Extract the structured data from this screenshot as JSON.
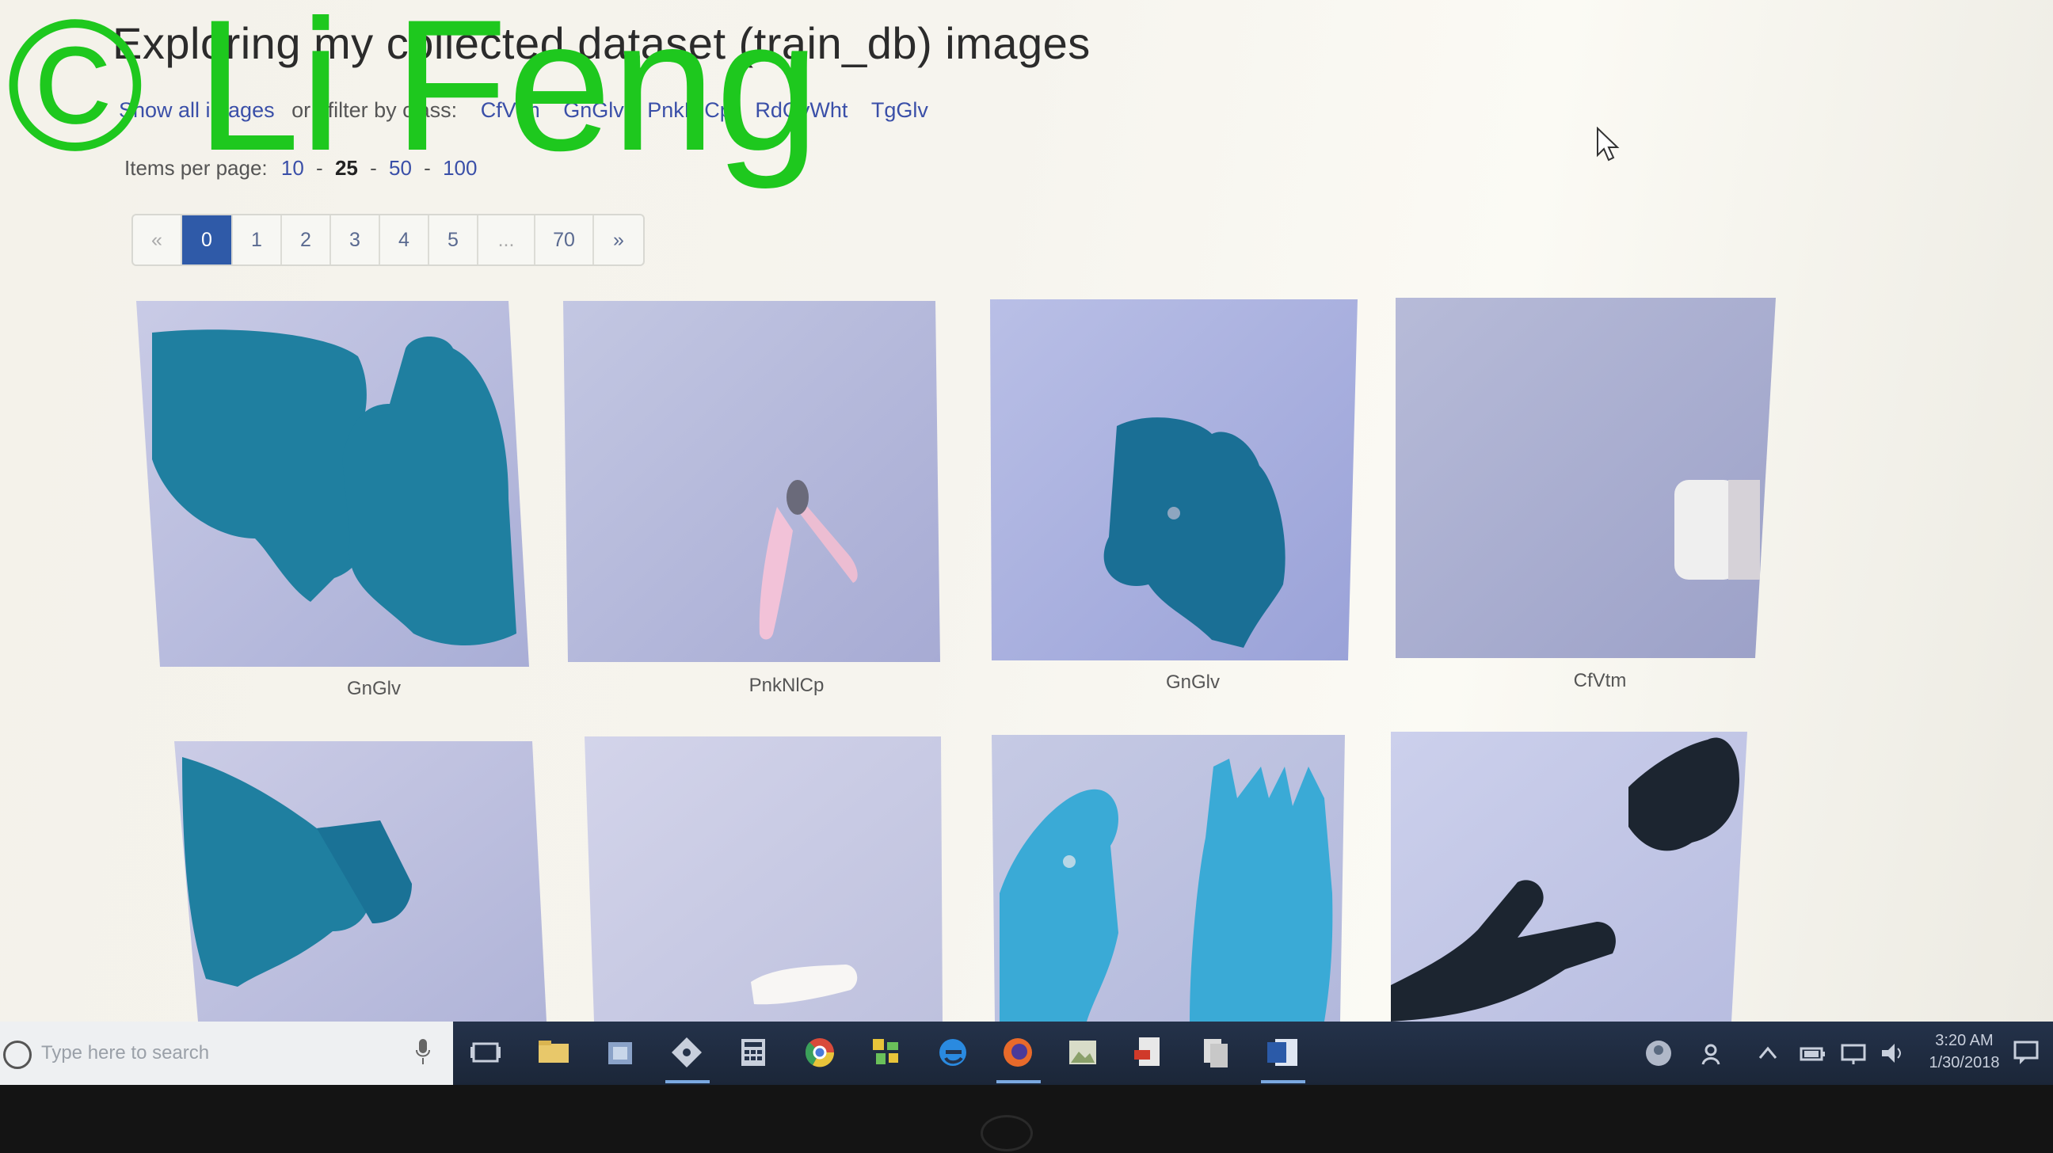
{
  "page": {
    "title": "Exploring my collected dataset (train_db) images",
    "show_all": "Show all images",
    "or": "or",
    "filter_by": "filter by class:",
    "classes": [
      "CfVtm",
      "GnGlv",
      "PnkNlCp",
      "RdGvWht",
      "TgGlv"
    ],
    "items_per_page_label": "Items per page:",
    "items_per_page_options": [
      "10",
      "25",
      "50",
      "100"
    ],
    "items_per_page_current": "25"
  },
  "pagination": {
    "prev": "«",
    "pages": [
      "0",
      "1",
      "2",
      "3",
      "4",
      "5",
      "...",
      "70"
    ],
    "active": "0",
    "next": "»"
  },
  "grid": {
    "captions": [
      "GnGlv",
      "PnkNlCp",
      "GnGlv",
      "CfVtm"
    ]
  },
  "taskbar": {
    "search_placeholder": "Type here to search",
    "icons": [
      "task-view-icon",
      "file-explorer-icon",
      "store-icon",
      "git-icon",
      "calculator-icon",
      "chrome-icon",
      "app-tiles-icon",
      "edge-icon",
      "firefox-icon",
      "photos-icon",
      "pdf-icon",
      "document-icon",
      "word-icon"
    ],
    "time": "3:20 AM",
    "date": "1/30/2018"
  },
  "watermark": "© Li Feng",
  "colors": {
    "glove_teal": "#1f7fa0",
    "glove_light": "#3aaad6",
    "glove_black": "#1c2530",
    "pink_clip": "#f2c2d8",
    "accent_blue": "#2f5aa8",
    "watermark_green": "#1ec81e"
  }
}
